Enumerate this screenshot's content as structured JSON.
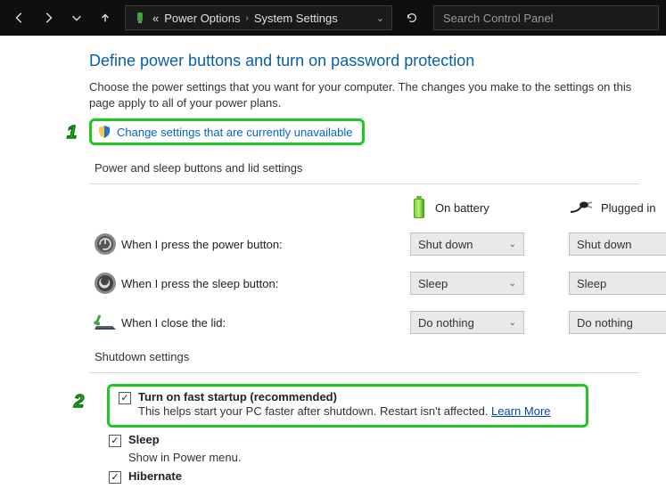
{
  "breadcrumb": {
    "prefix": "«",
    "items": [
      "Power Options",
      "System Settings"
    ]
  },
  "search": {
    "placeholder": "Search Control Panel"
  },
  "page": {
    "title": "Define power buttons and turn on password protection",
    "description": "Choose the power settings that you want for your computer. The changes you make to the settings on this page apply to all of your power plans.",
    "change_link": "Change settings that are currently unavailable"
  },
  "annotations": {
    "num1": "1",
    "num2": "2"
  },
  "buttons_section": {
    "header": "Power and sleep buttons and lid settings",
    "columns": {
      "battery": "On battery",
      "plugged": "Plugged in"
    },
    "rows": [
      {
        "label": "When I press the power button:",
        "battery": "Shut down",
        "plugged": "Shut down"
      },
      {
        "label": "When I press the sleep button:",
        "battery": "Sleep",
        "plugged": "Sleep"
      },
      {
        "label": "When I close the lid:",
        "battery": "Do nothing",
        "plugged": "Do nothing"
      }
    ]
  },
  "shutdown_section": {
    "header": "Shutdown settings",
    "fast_startup": {
      "title": "Turn on fast startup (recommended)",
      "desc": "This helps start your PC faster after shutdown. Restart isn't affected. ",
      "learn_more": "Learn More"
    },
    "sleep": {
      "title": "Sleep",
      "desc": "Show in Power menu."
    },
    "hibernate": {
      "title": "Hibernate"
    }
  }
}
